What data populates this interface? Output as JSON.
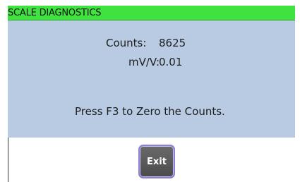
{
  "window": {
    "title": "SCALE DIAGNOSTICS"
  },
  "readings": {
    "counts_label": "Counts:",
    "counts_value": "8625",
    "mvv_label": "mV/V:",
    "mvv_value": "0.01"
  },
  "instruction": "Press F3 to Zero the Counts.",
  "actions": {
    "exit_label": "Exit"
  },
  "colors": {
    "title_bar": "#3fe23f",
    "panel": "#b8cbe2",
    "button_border": "#8b7fd6"
  }
}
